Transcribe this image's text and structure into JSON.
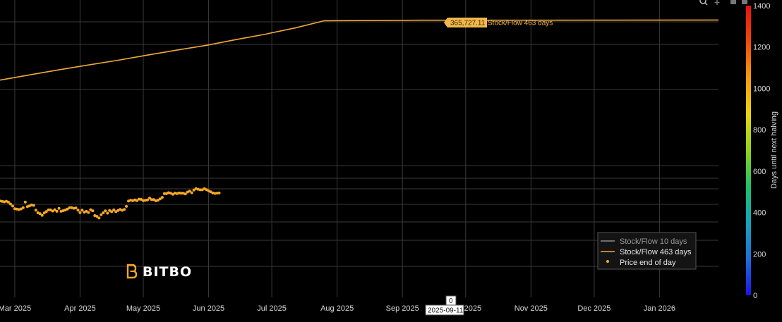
{
  "colors": {
    "background": "#000000",
    "grid": "#3a3a3a",
    "s2f_463": "#f2a93b",
    "s2f_10": "#8c8c8c",
    "price": "#f7a823",
    "legend_bg": "#1a1a1a",
    "tooltip_bg": "#f2b84b"
  },
  "toolbar": {
    "zoom_icon": "magnifier-icon",
    "pan_icon": "plus-icon"
  },
  "logo": {
    "text": "BITBO",
    "icon": "bitbo-logo-icon"
  },
  "hover": {
    "value_label": "365,727.11",
    "series_label": "Stock/Flow 463 days",
    "date_label": "2025-09-11",
    "color_value": "0"
  },
  "chart_data": {
    "type": "line",
    "x_axis": {
      "type": "date",
      "range": [
        "2025-02-22",
        "2026-01-29"
      ],
      "ticks": [
        {
          "date": "2025-03-01",
          "label": "Mar 2025"
        },
        {
          "date": "2025-04-01",
          "label": "Apr 2025"
        },
        {
          "date": "2025-05-01",
          "label": "May 2025"
        },
        {
          "date": "2025-06-01",
          "label": "Jun 2025"
        },
        {
          "date": "2025-07-01",
          "label": "Jul 2025"
        },
        {
          "date": "2025-08-01",
          "label": "Aug 2025"
        },
        {
          "date": "2025-09-01",
          "label": "Sep 2025"
        },
        {
          "date": "2025-10-01",
          "label": "Oct 2025"
        },
        {
          "date": "2025-11-01",
          "label": "Nov 2025"
        },
        {
          "date": "2025-12-01",
          "label": "Dec 2025"
        },
        {
          "date": "2026-01-01",
          "label": "Jan 2026"
        }
      ]
    },
    "y_axis": {
      "type": "log",
      "tick_labels_visible": false
    },
    "colorbar": {
      "title": "Days until next halving",
      "range": [
        0,
        1400
      ],
      "ticks": [
        0,
        200,
        400,
        600,
        800,
        1000,
        1200,
        1400
      ],
      "colorscale": [
        "#1a14e6",
        "#1e6fd9",
        "#16a3b8",
        "#1fbf6a",
        "#8fd21a",
        "#e8d414",
        "#f59b0f",
        "#ee4a0c",
        "#e81010"
      ]
    },
    "legend": {
      "placement": "bottom-right",
      "entries": [
        {
          "name": "Stock/Flow 10 days",
          "kind": "line",
          "color": "#8c8c8c",
          "dim": true
        },
        {
          "name": "Stock/Flow 463 days",
          "kind": "line",
          "color": "#f2a93b",
          "dim": false
        },
        {
          "name": "Price end of day",
          "kind": "marker",
          "color": "#f7a823",
          "dim": false
        }
      ]
    },
    "series": [
      {
        "name": "Stock/Flow 463 days",
        "kind": "line",
        "points": [
          {
            "x": "2025-02-22",
            "y": 220000
          },
          {
            "x": "2025-03-08",
            "y": 228000
          },
          {
            "x": "2025-03-22",
            "y": 236000
          },
          {
            "x": "2025-04-05",
            "y": 244000
          },
          {
            "x": "2025-04-19",
            "y": 252000
          },
          {
            "x": "2025-05-03",
            "y": 261000
          },
          {
            "x": "2025-05-17",
            "y": 270000
          },
          {
            "x": "2025-05-31",
            "y": 279000
          },
          {
            "x": "2025-06-14",
            "y": 290000
          },
          {
            "x": "2025-06-28",
            "y": 301000
          },
          {
            "x": "2025-07-12",
            "y": 314000
          },
          {
            "x": "2025-07-26",
            "y": 330000
          },
          {
            "x": "2025-09-11",
            "y": 331000
          },
          {
            "x": "2025-11-01",
            "y": 331000
          },
          {
            "x": "2026-01-29",
            "y": 331500
          }
        ]
      },
      {
        "name": "Price end of day",
        "kind": "scatter",
        "points": [
          {
            "x": "2025-02-22",
            "y": 96500
          },
          {
            "x": "2025-02-23",
            "y": 96200
          },
          {
            "x": "2025-02-24",
            "y": 95900
          },
          {
            "x": "2025-02-25",
            "y": 96300
          },
          {
            "x": "2025-02-26",
            "y": 95700
          },
          {
            "x": "2025-02-27",
            "y": 94500
          },
          {
            "x": "2025-02-28",
            "y": 93200
          },
          {
            "x": "2025-03-01",
            "y": 91500
          },
          {
            "x": "2025-03-02",
            "y": 91300
          },
          {
            "x": "2025-03-03",
            "y": 91000
          },
          {
            "x": "2025-03-04",
            "y": 91400
          },
          {
            "x": "2025-03-05",
            "y": 92200
          },
          {
            "x": "2025-03-06",
            "y": 95800
          },
          {
            "x": "2025-03-07",
            "y": 92800
          },
          {
            "x": "2025-03-08",
            "y": 93300
          },
          {
            "x": "2025-03-09",
            "y": 93900
          },
          {
            "x": "2025-03-10",
            "y": 93600
          },
          {
            "x": "2025-03-11",
            "y": 90600
          },
          {
            "x": "2025-03-12",
            "y": 89000
          },
          {
            "x": "2025-03-13",
            "y": 88500
          },
          {
            "x": "2025-03-14",
            "y": 87500
          },
          {
            "x": "2025-03-15",
            "y": 88900
          },
          {
            "x": "2025-03-16",
            "y": 89800
          },
          {
            "x": "2025-03-17",
            "y": 90800
          },
          {
            "x": "2025-03-18",
            "y": 90800
          },
          {
            "x": "2025-03-19",
            "y": 90100
          },
          {
            "x": "2025-03-20",
            "y": 90900
          },
          {
            "x": "2025-03-21",
            "y": 89900
          },
          {
            "x": "2025-03-22",
            "y": 91700
          },
          {
            "x": "2025-03-23",
            "y": 89900
          },
          {
            "x": "2025-03-24",
            "y": 90300
          },
          {
            "x": "2025-03-25",
            "y": 90700
          },
          {
            "x": "2025-03-26",
            "y": 91300
          },
          {
            "x": "2025-03-27",
            "y": 92200
          },
          {
            "x": "2025-03-28",
            "y": 92200
          },
          {
            "x": "2025-03-29",
            "y": 91800
          },
          {
            "x": "2025-03-30",
            "y": 92000
          },
          {
            "x": "2025-03-31",
            "y": 90600
          },
          {
            "x": "2025-04-01",
            "y": 89100
          },
          {
            "x": "2025-04-02",
            "y": 90600
          },
          {
            "x": "2025-04-03",
            "y": 89400
          },
          {
            "x": "2025-04-04",
            "y": 89900
          },
          {
            "x": "2025-04-05",
            "y": 89200
          },
          {
            "x": "2025-04-06",
            "y": 90900
          },
          {
            "x": "2025-04-07",
            "y": 90200
          },
          {
            "x": "2025-04-08",
            "y": 87300
          },
          {
            "x": "2025-04-09",
            "y": 86900
          },
          {
            "x": "2025-04-10",
            "y": 85900
          },
          {
            "x": "2025-04-11",
            "y": 87800
          },
          {
            "x": "2025-04-12",
            "y": 89000
          },
          {
            "x": "2025-04-13",
            "y": 90200
          },
          {
            "x": "2025-04-14",
            "y": 88800
          },
          {
            "x": "2025-04-15",
            "y": 90400
          },
          {
            "x": "2025-04-16",
            "y": 89700
          },
          {
            "x": "2025-04-17",
            "y": 90800
          },
          {
            "x": "2025-04-18",
            "y": 89700
          },
          {
            "x": "2025-04-19",
            "y": 90400
          },
          {
            "x": "2025-04-20",
            "y": 91100
          },
          {
            "x": "2025-04-21",
            "y": 90500
          },
          {
            "x": "2025-04-22",
            "y": 91100
          },
          {
            "x": "2025-04-23",
            "y": 93000
          },
          {
            "x": "2025-04-24",
            "y": 96500
          },
          {
            "x": "2025-04-25",
            "y": 96900
          },
          {
            "x": "2025-04-26",
            "y": 96700
          },
          {
            "x": "2025-04-27",
            "y": 97200
          },
          {
            "x": "2025-04-28",
            "y": 96700
          },
          {
            "x": "2025-04-29",
            "y": 97700
          },
          {
            "x": "2025-04-30",
            "y": 97500
          },
          {
            "x": "2025-05-01",
            "y": 96700
          },
          {
            "x": "2025-05-02",
            "y": 96900
          },
          {
            "x": "2025-05-03",
            "y": 97200
          },
          {
            "x": "2025-05-04",
            "y": 98400
          },
          {
            "x": "2025-05-05",
            "y": 97400
          },
          {
            "x": "2025-05-06",
            "y": 97400
          },
          {
            "x": "2025-05-07",
            "y": 96600
          },
          {
            "x": "2025-05-08",
            "y": 97000
          },
          {
            "x": "2025-05-09",
            "y": 97900
          },
          {
            "x": "2025-05-10",
            "y": 98900
          },
          {
            "x": "2025-05-11",
            "y": 101500
          },
          {
            "x": "2025-05-12",
            "y": 101400
          },
          {
            "x": "2025-05-13",
            "y": 102100
          },
          {
            "x": "2025-05-14",
            "y": 101800
          },
          {
            "x": "2025-05-15",
            "y": 101000
          },
          {
            "x": "2025-05-16",
            "y": 101800
          },
          {
            "x": "2025-05-17",
            "y": 101500
          },
          {
            "x": "2025-05-18",
            "y": 101900
          },
          {
            "x": "2025-05-19",
            "y": 101700
          },
          {
            "x": "2025-05-20",
            "y": 101700
          },
          {
            "x": "2025-05-21",
            "y": 101200
          },
          {
            "x": "2025-05-22",
            "y": 102500
          },
          {
            "x": "2025-05-23",
            "y": 103200
          },
          {
            "x": "2025-05-24",
            "y": 102100
          },
          {
            "x": "2025-05-25",
            "y": 103900
          },
          {
            "x": "2025-05-26",
            "y": 105000
          },
          {
            "x": "2025-05-27",
            "y": 104500
          },
          {
            "x": "2025-05-28",
            "y": 104100
          },
          {
            "x": "2025-05-29",
            "y": 104100
          },
          {
            "x": "2025-05-30",
            "y": 104900
          },
          {
            "x": "2025-05-31",
            "y": 104200
          },
          {
            "x": "2025-06-01",
            "y": 103400
          },
          {
            "x": "2025-06-02",
            "y": 102700
          },
          {
            "x": "2025-06-03",
            "y": 101900
          },
          {
            "x": "2025-06-04",
            "y": 101600
          },
          {
            "x": "2025-06-05",
            "y": 101800
          },
          {
            "x": "2025-06-06",
            "y": 101900
          }
        ]
      }
    ]
  }
}
